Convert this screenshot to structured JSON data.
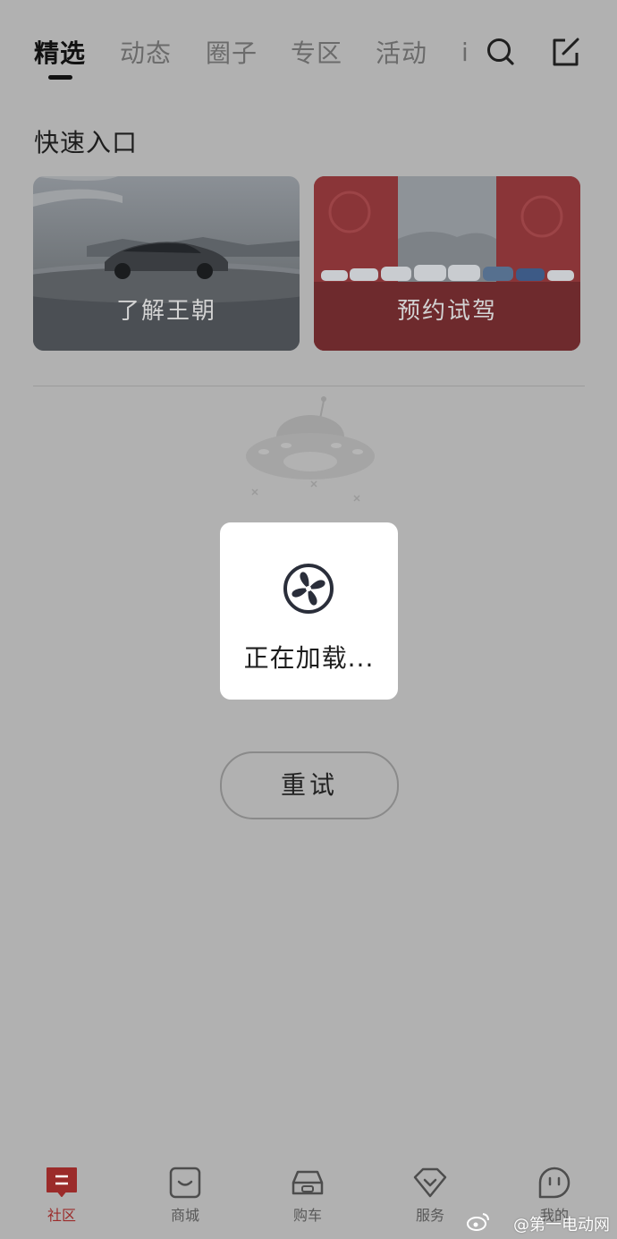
{
  "header": {
    "tabs": [
      {
        "label": "精选",
        "active": true
      },
      {
        "label": "动态",
        "active": false
      },
      {
        "label": "圈子",
        "active": false
      },
      {
        "label": "专区",
        "active": false
      },
      {
        "label": "活动",
        "active": false
      }
    ],
    "overflow_tab_fragment": "i",
    "icons": [
      "search-icon",
      "edit-icon"
    ]
  },
  "quick_entry": {
    "title": "快速入口",
    "cards": [
      {
        "label": "了解王朝"
      },
      {
        "label": "预约试驾"
      }
    ]
  },
  "loading": {
    "text": "正在加载..."
  },
  "retry": {
    "label": "重试"
  },
  "bottom_nav": {
    "items": [
      {
        "label": "社区",
        "icon": "community-icon",
        "active": true
      },
      {
        "label": "商城",
        "icon": "shop-bag-icon",
        "active": false
      },
      {
        "label": "购车",
        "icon": "car-icon",
        "active": false
      },
      {
        "label": "服务",
        "icon": "service-diamond-icon",
        "active": false
      },
      {
        "label": "我的",
        "icon": "profile-face-icon",
        "active": false
      }
    ]
  },
  "colors": {
    "overlay_bg": "#b1b1b1",
    "accent": "#9b2b2a",
    "dialog_bg": "#ffffff"
  },
  "watermark": {
    "text": "@第一电动网"
  }
}
